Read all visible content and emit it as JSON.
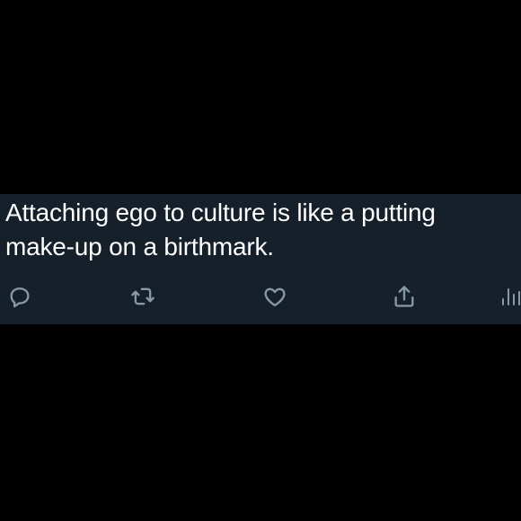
{
  "tweet": {
    "text": "Attaching ego to culture is like a putting\nmake-up on a birthmark."
  },
  "actions": [
    {
      "name": "reply",
      "icon": "comment-bubble-icon"
    },
    {
      "name": "retweet",
      "icon": "retweet-icon"
    },
    {
      "name": "like",
      "icon": "heart-icon"
    },
    {
      "name": "share",
      "icon": "share-icon"
    },
    {
      "name": "analytics",
      "icon": "analytics-bars-icon"
    }
  ],
  "colors": {
    "background": "#000000",
    "card": "#15202b",
    "text": "#ffffff",
    "icon": "#8899a6"
  }
}
